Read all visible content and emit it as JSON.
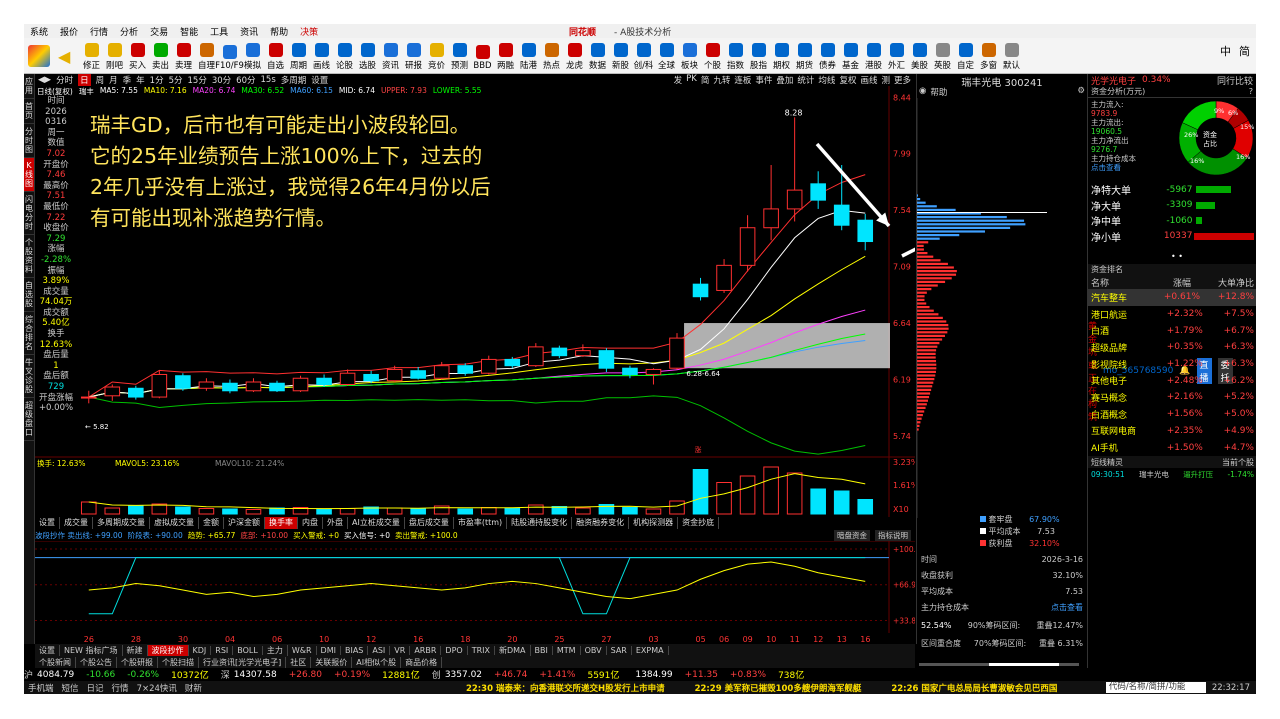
{
  "titlebar": {
    "menu": [
      "系统",
      "报价",
      "行情",
      "分析",
      "交易",
      "智能",
      "工具",
      "资讯",
      "帮助",
      "决策"
    ],
    "logo": "同花顺",
    "title": "- A股技术分析",
    "notice": "黄金坑或正在构筑",
    "user": "mo_565768590",
    "direct": "直播",
    "entrust": "委托"
  },
  "toolbar": {
    "items": [
      "修正",
      "刚吧",
      "买入",
      "卖出",
      "卖理",
      "自理",
      "F10/F9",
      "模拟",
      "自选",
      "周期",
      "画线",
      "论股",
      "选股",
      "资讯",
      "研报",
      "竞价",
      "预测",
      "BBD",
      "两融",
      "陆港",
      "热点",
      "龙虎",
      "数据",
      "新股",
      "创/科",
      "全球",
      "板块",
      "个股",
      "指数",
      "股指",
      "期权",
      "期货",
      "债券",
      "基金",
      "港股",
      "外汇",
      "美股",
      "英股",
      "自定",
      "多窗",
      "默认"
    ],
    "langs": [
      "中",
      "简"
    ]
  },
  "sidetabs": [
    "应用",
    "首页",
    "分时图",
    "K线图",
    "闪电分时",
    "个股资料",
    "自选股",
    "综合排名",
    "牛叉诊股",
    "超级盘口"
  ],
  "chartbar": {
    "items": [
      "分时",
      "日",
      "周",
      "月",
      "季",
      "年",
      "1分",
      "5分",
      "15分",
      "30分",
      "60分",
      "15s",
      "多周期",
      "设置"
    ],
    "right": [
      "发",
      "PK",
      "简",
      "九转",
      "连板",
      "事件",
      "叠加",
      "统计",
      "均线",
      "复权",
      "画线",
      "测",
      "更多"
    ]
  },
  "legend": {
    "type": "日线(复权)",
    "name": "瑞丰",
    "ma5": "MA5: 7.55",
    "ma10": "MA10: 7.16",
    "ma20": "MA20: 6.74",
    "ma30": "MA30: 6.52",
    "ma60": "MA60: 6.15",
    "mid": "MID: 6.74",
    "upper": "UPPER: 7.93",
    "lower": "LOWER: 5.55"
  },
  "info": {
    "rows": [
      [
        "时间",
        "2026",
        "0316",
        "周一"
      ],
      [
        "数值",
        "7.02"
      ],
      [
        "开盘价",
        "7.46"
      ],
      [
        "最高价",
        "7.51"
      ],
      [
        "最低价",
        "7.22"
      ],
      [
        "收盘价",
        "7.29"
      ],
      [
        "涨幅",
        "-2.28%"
      ],
      [
        "振幅",
        "3.89%"
      ],
      [
        "成交量",
        "74.04万"
      ],
      [
        "成交额",
        "5.40亿"
      ],
      [
        "换手",
        "12.63%"
      ],
      [
        "盘后量",
        "1"
      ],
      [
        "盘后额",
        "729"
      ],
      [
        "开盘涨幅",
        "+0.00%"
      ]
    ]
  },
  "annotation": [
    "瑞丰GD，后市也有可能走出小波段轮回。",
    "它的25年业绩预告上涨100%上下，过去的",
    "2年几乎没有上涨过，我觉得26年4月份以后",
    "有可能出现补涨趋势行情。"
  ],
  "price_axis": [
    "8.44",
    "7.99",
    "7.54",
    "7.09",
    "6.64",
    "6.19",
    "5.74"
  ],
  "chart_labels": {
    "high": "8.28",
    "box": "6.28-6.64",
    "low": "5.82",
    "zhang": "涨"
  },
  "chart_data": {
    "type": "candlestick",
    "dates": [
      "26",
      "27",
      "28",
      "29",
      "30",
      "03",
      "04",
      "05",
      "06",
      "09",
      "10",
      "11",
      "12",
      "13",
      "16",
      "17",
      "18",
      "19",
      "20",
      "24",
      "25",
      "26",
      "27",
      "02",
      "03",
      "04",
      "05",
      "06",
      "09",
      "10",
      "11",
      "12",
      "13",
      "16"
    ],
    "ohlc": [
      [
        6.05,
        6.05,
        6.0,
        6.1
      ],
      [
        6.06,
        6.13,
        6.02,
        6.15
      ],
      [
        6.12,
        6.05,
        6.03,
        6.14
      ],
      [
        6.05,
        6.23,
        6.04,
        6.26
      ],
      [
        6.22,
        6.12,
        6.1,
        6.24
      ],
      [
        6.12,
        6.17,
        6.1,
        6.2
      ],
      [
        6.16,
        6.1,
        6.08,
        6.19
      ],
      [
        6.1,
        6.17,
        6.09,
        6.2
      ],
      [
        6.16,
        6.1,
        6.09,
        6.18
      ],
      [
        6.1,
        6.2,
        6.09,
        6.22
      ],
      [
        6.2,
        6.15,
        6.13,
        6.23
      ],
      [
        6.15,
        6.24,
        6.14,
        6.27
      ],
      [
        6.23,
        6.18,
        6.16,
        6.26
      ],
      [
        6.18,
        6.27,
        6.17,
        6.3
      ],
      [
        6.26,
        6.2,
        6.19,
        6.29
      ],
      [
        6.2,
        6.3,
        6.19,
        6.33
      ],
      [
        6.3,
        6.24,
        6.22,
        6.32
      ],
      [
        6.24,
        6.35,
        6.23,
        6.38
      ],
      [
        6.35,
        6.3,
        6.28,
        6.37
      ],
      [
        6.3,
        6.45,
        6.29,
        6.48
      ],
      [
        6.44,
        6.38,
        6.36,
        6.46
      ],
      [
        6.38,
        6.42,
        6.37,
        6.47
      ],
      [
        6.42,
        6.28,
        6.25,
        6.44
      ],
      [
        6.28,
        6.23,
        6.2,
        6.3
      ],
      [
        6.23,
        6.27,
        6.15,
        6.28
      ],
      [
        6.28,
        6.52,
        6.27,
        6.56
      ],
      [
        6.95,
        6.85,
        6.82,
        7.0
      ],
      [
        6.9,
        7.1,
        6.88,
        7.15
      ],
      [
        7.1,
        7.4,
        7.05,
        7.5
      ],
      [
        7.4,
        7.55,
        7.3,
        7.9
      ],
      [
        7.55,
        7.7,
        7.45,
        8.28
      ],
      [
        7.75,
        7.62,
        7.55,
        7.85
      ],
      [
        7.58,
        7.42,
        7.38,
        7.9
      ],
      [
        7.46,
        7.29,
        7.22,
        7.51
      ]
    ],
    "turnover_axis": [
      "3.23%",
      "1.61%",
      "X10"
    ],
    "oscillator_axis": [
      "+100.0",
      "+66.91",
      "+33.81"
    ]
  },
  "subtabs": [
    "设置",
    "成交量",
    "多周期成交量",
    "虚拟成交量",
    "金额",
    "沪深金额",
    "换手率",
    "内盘",
    "外盘",
    "AI立桩成交量",
    "盘后成交量",
    "市盈率(ttm)",
    "陆股通持股变化",
    "融资融券变化",
    "机构探测器",
    "资金抄底"
  ],
  "turnover_legend": {
    "a": "换手: 12.63%",
    "b": "MAVOL5: 23.16%",
    "c": "MAVOL10: 21.24%"
  },
  "wave_legend": {
    "a": "波段抄作 卖出线: +99.00",
    "b": "阶段表: +90.00",
    "c": "趋势: +65.77",
    "d": "底部: +10.00",
    "e": "买入警戒: +0",
    "f": "买入信号: +0",
    "g": "卖出警戒: +100.0",
    "h": "暗盘资金",
    "i": "指标说明"
  },
  "btmtabs": [
    "设置",
    "NEW 指标广场",
    "新建",
    "波段抄作",
    "KDJ",
    "RSI",
    "BOLL",
    "主力",
    "W&R",
    "DMI",
    "BIAS",
    "ASI",
    "VR",
    "ARBR",
    "DPO",
    "TRIX",
    "新DMA",
    "BBI",
    "MTM",
    "OBV",
    "SAR",
    "EXPMA"
  ],
  "btmtabs2": [
    "个股新闻",
    "个股公告",
    "个股研报",
    "个股扫描",
    "行业资讯[光学光电子]",
    "社区",
    "关联报价",
    "AI相似个股",
    "商品价格"
  ],
  "status": [
    [
      "沪",
      "4084.79",
      "-10.66",
      "-0.26%",
      "10372亿"
    ],
    [
      "深",
      "14307.58",
      "+26.80",
      "+0.19%",
      "12881亿"
    ],
    [
      "创",
      "3357.02",
      "+46.74",
      "+1.41%",
      "5591亿"
    ],
    [
      "",
      "1384.99",
      "+11.35",
      "+0.83%",
      "738亿"
    ]
  ],
  "status2": {
    "left": [
      "手机端",
      "短信",
      "日记",
      "行情",
      "7×24快讯",
      "财新"
    ],
    "news": [
      "22:30 瑞泰来：向香港联交所递交H股发行上市申请",
      "22:29 美军称已摧毁100多艘伊朗海军舰艇",
      "22:26 国家广电总局局长曹淑敏会见巴西国"
    ],
    "search": "代码/名称/简拼/功能",
    "time": "22:32:17"
  },
  "mid": {
    "title": "瑞丰光电 300241",
    "help": "帮助",
    "legend": [
      [
        "套牢盘",
        "67.90%"
      ],
      [
        "平均成本",
        "7.53"
      ],
      [
        "获利盘",
        "32.10%"
      ]
    ],
    "time": [
      "时间",
      "2026-3-16"
    ],
    "profit": [
      "收盘获利",
      "32.10%"
    ],
    "avgcost": [
      "平均成本",
      "7.53"
    ],
    "main": [
      "主力持仓成本",
      "点击查看"
    ],
    "pct90": [
      "52.54%",
      "90%筹码区间:",
      "重叠12.47%"
    ],
    "pct70": [
      "区间重合度",
      "70%筹码区间:",
      "重叠 6.31%"
    ],
    "v1": "6.90",
    "v2": "7.93",
    "v3": "6.21",
    "v4": "7.98",
    "btabs": [
      "细",
      "分",
      "筹",
      "信",
      "指",
      "四"
    ]
  },
  "right": {
    "name": "光学光电子",
    "chg": "0.34%",
    "rank": "同行比较",
    "fund": "资金分析(万元)",
    "inflow": [
      "主力流入:",
      "9783.9"
    ],
    "outflow": [
      "主力流出:",
      "19060.5"
    ],
    "netout": [
      "主力净流出",
      "9276.7"
    ],
    "hold": [
      "主力持仓成本",
      "点击查看"
    ],
    "pie": [
      "9%",
      "6%",
      "15%",
      "16%",
      "16%",
      "26%"
    ],
    "pie_center": "资金占比",
    "flows": [
      [
        "净特大单",
        "-5967"
      ],
      [
        "净大单",
        "-3309"
      ],
      [
        "净中单",
        "-1060"
      ],
      [
        "净小单",
        "10337"
      ]
    ],
    "rank_title": "资金排名",
    "cols": [
      "名称",
      "涨幅",
      "大单净比"
    ],
    "rows": [
      [
        "汽车整车",
        "+0.61%",
        "+12.8%"
      ],
      [
        "港口航运",
        "+2.32%",
        "+7.5%"
      ],
      [
        "白酒",
        "+1.79%",
        "+6.7%"
      ],
      [
        "超级品牌",
        "+0.35%",
        "+6.3%"
      ],
      [
        "影视院线",
        "+1.22%",
        "+6.3%"
      ],
      [
        "其他电子",
        "+2.48%",
        "+6.2%"
      ],
      [
        "赛马概念",
        "+2.16%",
        "+5.2%"
      ],
      [
        "白酒概念",
        "+1.56%",
        "+5.0%"
      ],
      [
        "互联网电商",
        "+2.35%",
        "+4.9%"
      ],
      [
        "AI手机",
        "+1.50%",
        "+4.7%"
      ]
    ],
    "wizard": "短线精灵",
    "wiz_tab": "当前个股",
    "wiz_row": [
      "09:30:51",
      "瑞丰光电",
      "逼升打压",
      "-1.74%"
    ]
  },
  "colors": {
    "up": "#ff3030",
    "down": "#00e5ff",
    "ma5": "#ffffff",
    "ma10": "#ffff00",
    "ma20": "#ff40ff",
    "ma30": "#00ff00",
    "ma60": "#3fa0ff",
    "annot": "#ffe45c"
  }
}
